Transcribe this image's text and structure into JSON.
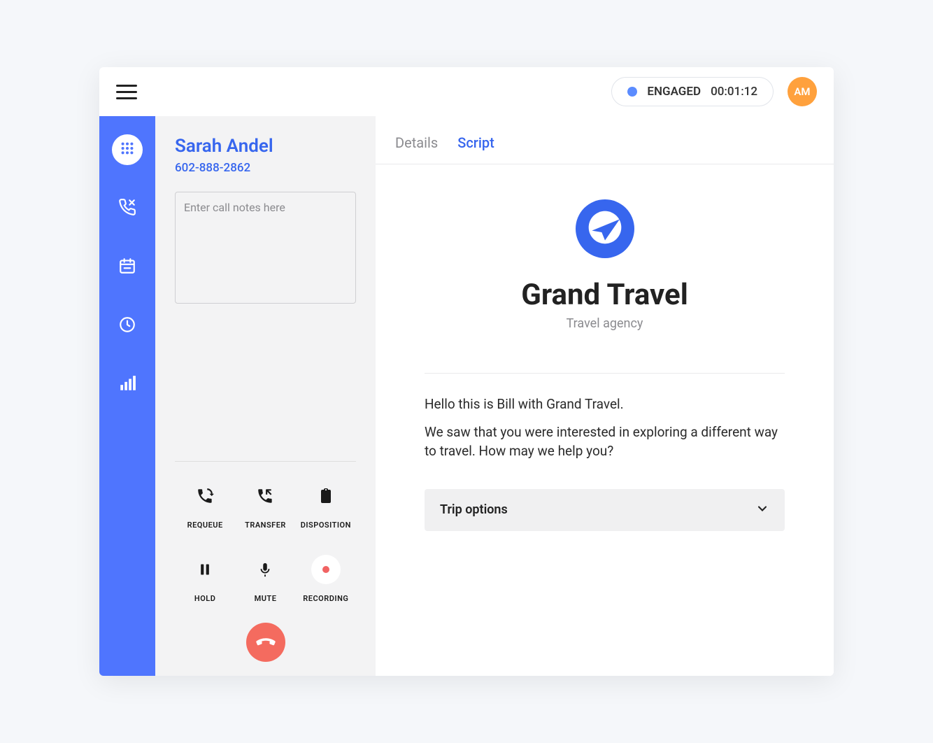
{
  "topbar": {
    "status_label": "ENGAGED",
    "timer": "00:01:12",
    "avatar_initials": "AM",
    "colors": {
      "status_dot": "#5b8cff",
      "avatar": "#ffa13d"
    }
  },
  "sidebar": {
    "items": [
      {
        "name": "dialpad-icon",
        "active": true
      },
      {
        "name": "call-out-icon",
        "active": false
      },
      {
        "name": "calendar-icon",
        "active": false
      },
      {
        "name": "clock-icon",
        "active": false
      },
      {
        "name": "stats-icon",
        "active": false
      }
    ]
  },
  "caller": {
    "name": "Sarah Andel",
    "phone": "602-888-2862",
    "notes_placeholder": "Enter call notes here"
  },
  "controls": {
    "requeue": "REQUEUE",
    "transfer": "TRANSFER",
    "disposition": "DISPOSITION",
    "hold": "HOLD",
    "mute": "MUTE",
    "recording": "RECORDING"
  },
  "tabs": {
    "details": "Details",
    "script": "Script",
    "active": "script"
  },
  "org": {
    "name": "Grand Travel",
    "subtitle": "Travel agency"
  },
  "script": {
    "line1": "Hello this is Bill with Grand Travel.",
    "line2": "We saw that you were interested in exploring a different way to travel. How may we help you?"
  },
  "accordion": {
    "title": "Trip options"
  }
}
